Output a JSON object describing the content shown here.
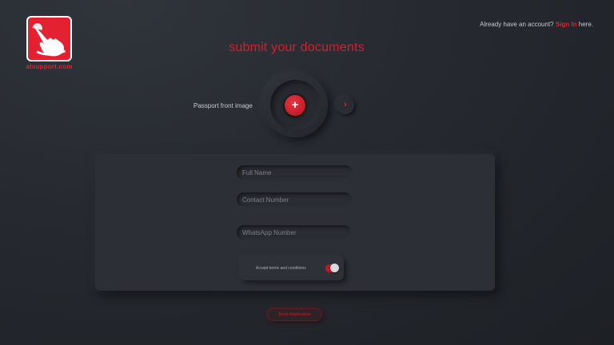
{
  "brand": {
    "logo_text": "atsupport.com",
    "logo_icon": "hand-pointer-icon",
    "accent_color": "#e32130"
  },
  "header": {
    "signin_prefix": "Already have an account?",
    "signin_link": "Sign In",
    "signin_suffix": "here."
  },
  "page_title": "submit your documents",
  "upload": {
    "label": "Passport front image",
    "add_icon": "plus-icon",
    "add_glyph": "+",
    "next_icon": "chevron-right-icon",
    "next_glyph": "›"
  },
  "form": {
    "full_name": {
      "placeholder": "Full Name",
      "value": ""
    },
    "contact_number": {
      "placeholder": "Contact Number",
      "value": ""
    },
    "whatsapp_number": {
      "placeholder": "WhatsApp Number",
      "value": ""
    },
    "terms_label": "Accept terms and conditions",
    "terms_accepted": true,
    "submit_label": "Send Application"
  }
}
